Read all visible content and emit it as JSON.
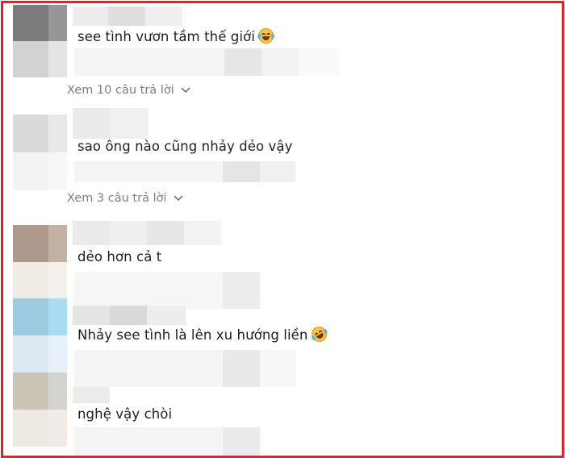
{
  "comments": [
    {
      "text": "see tình vươn tầm thế giới",
      "emoji": "face-with-tears-of-joy-icon"
    },
    {
      "text": "sao ông nào cũng nhảy dẻo vậy",
      "emoji": ""
    },
    {
      "text": "dẻo hơn cả t",
      "emoji": ""
    },
    {
      "text": "Nhảy see tình là lên xu hướng liền",
      "emoji": "rolling-on-floor-laughing-icon"
    },
    {
      "text": "nghệ vậy chòi",
      "emoji": ""
    }
  ],
  "replies": [
    {
      "label": "Xem 10 câu trả lời"
    },
    {
      "label": "Xem 3 câu trả lời"
    }
  ],
  "colors": {
    "frame_border": "#ee1c25",
    "reply_link": "#7a7f86",
    "comment_text": "#1c1e21"
  }
}
